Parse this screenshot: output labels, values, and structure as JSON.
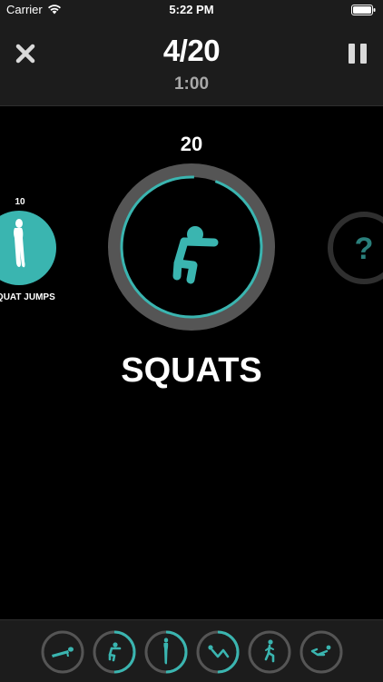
{
  "status_bar": {
    "carrier": "Carrier",
    "time": "5:22 PM"
  },
  "header": {
    "progress": "4/20",
    "elapsed": "1:00"
  },
  "current_exercise": {
    "reps": "20",
    "name": "SQUATS",
    "ring_progress": 0.95,
    "icon": "squat-figure-icon"
  },
  "previous_exercise": {
    "reps": "10",
    "name": "SQUAT JUMPS",
    "icon": "jump-figure-icon"
  },
  "next_exercise": {
    "symbol": "?"
  },
  "exercise_strip": [
    {
      "icon": "pushup-figure-icon",
      "progress": 0
    },
    {
      "icon": "squat-figure-icon",
      "progress": 0.5
    },
    {
      "icon": "jump-figure-icon",
      "progress": 0.5
    },
    {
      "icon": "situp-figure-icon",
      "progress": 0.5
    },
    {
      "icon": "lunge-figure-icon",
      "progress": 0
    },
    {
      "icon": "crunch-figure-icon",
      "progress": 0
    }
  ],
  "colors": {
    "accent": "#3ab5b0",
    "ring_track": "#555555",
    "bar_background": "#1c1c1c",
    "background": "#000000"
  }
}
